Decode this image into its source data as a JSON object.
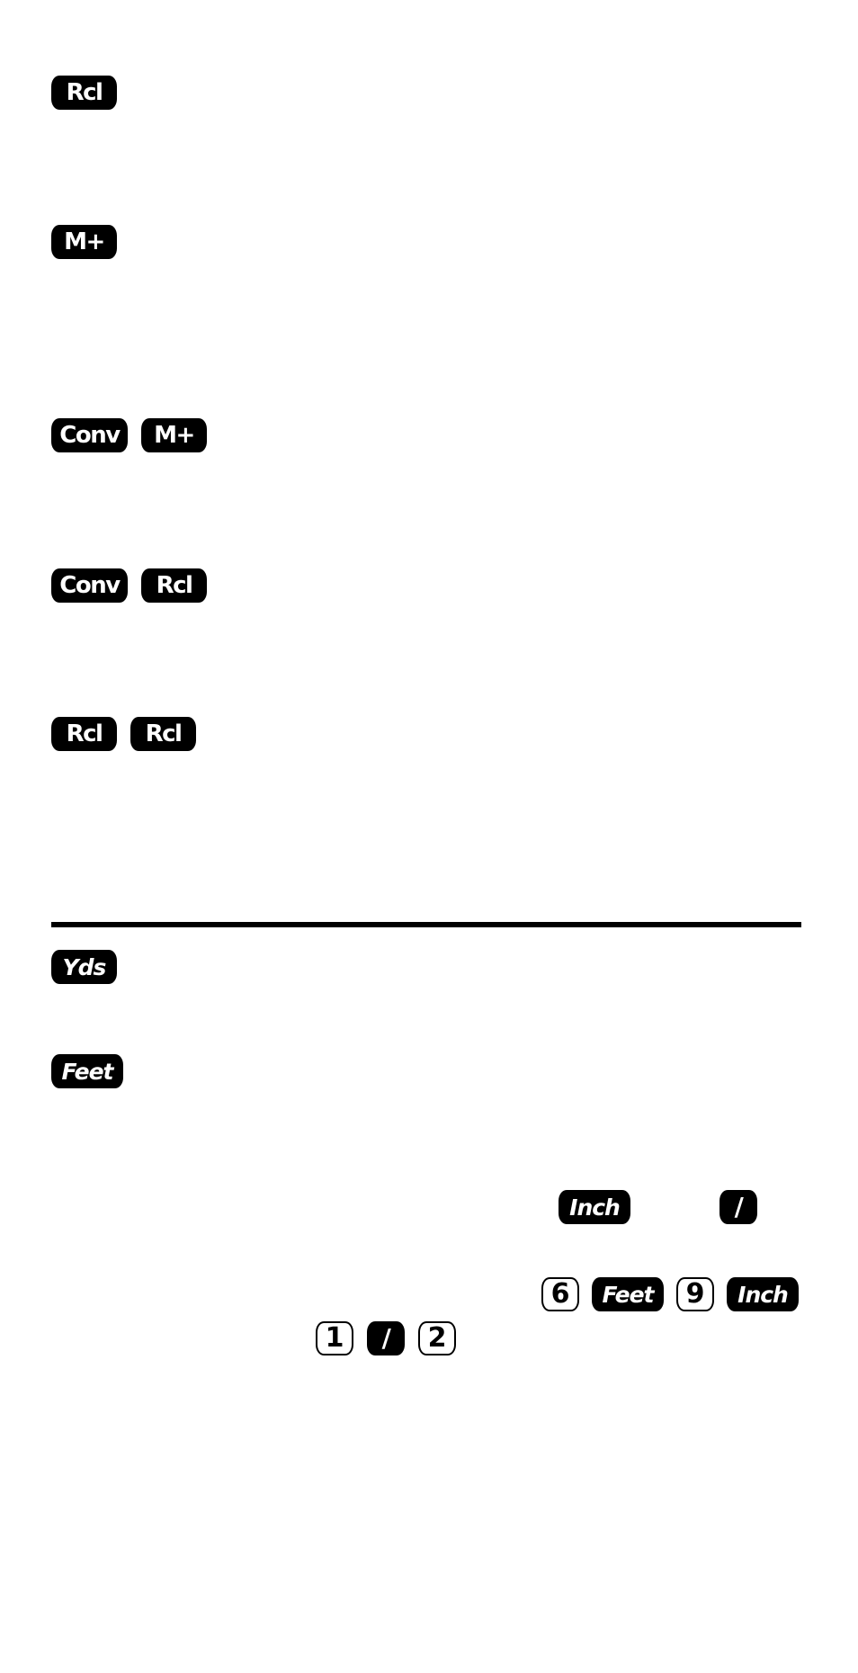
{
  "document": {
    "sections": [
      {
        "id": "recall",
        "keys": [
          "Rcl"
        ]
      },
      {
        "id": "memory-add",
        "keys": [
          "M+"
        ]
      },
      {
        "id": "conv-memory-add",
        "keys": [
          "Conv",
          "M+"
        ]
      },
      {
        "id": "conv-recall",
        "keys": [
          "Conv",
          "Rcl"
        ]
      },
      {
        "id": "recall-recall",
        "keys": [
          "Rcl",
          "Rcl"
        ]
      }
    ],
    "units": {
      "yards_key": "Yds",
      "feet_key": "Feet",
      "inch_key": "Inch",
      "fraction_key": "/"
    },
    "example": {
      "row1": [
        "6",
        "Feet",
        "9",
        "Inch"
      ],
      "row2": [
        "1",
        "/",
        "2"
      ]
    }
  },
  "colors": {
    "key_fill": "#000000",
    "key_text": "#ffffff",
    "number_key_fill": "#ffffff",
    "number_key_text": "#000000",
    "rule": "#000000",
    "background": "#ffffff"
  }
}
